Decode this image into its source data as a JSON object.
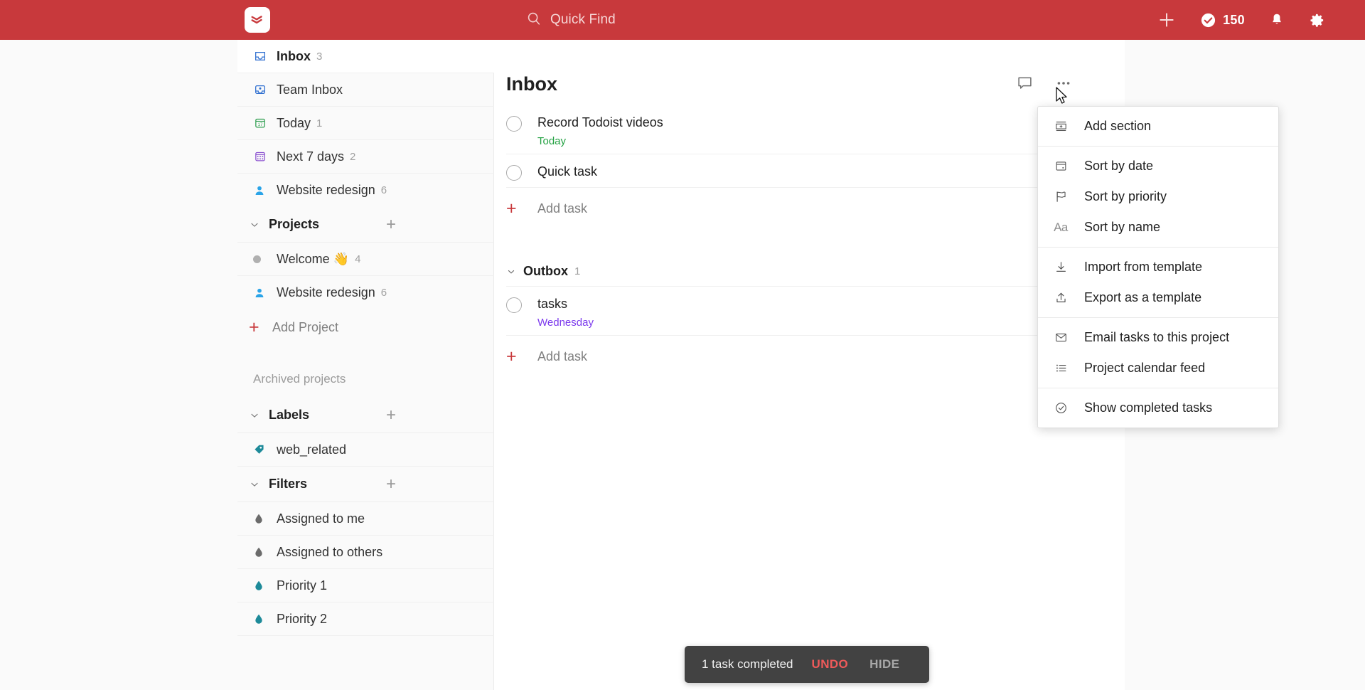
{
  "topbar": {
    "logo_name": "todoist-logo",
    "search_placeholder": "Quick Find",
    "add_label": "+",
    "karma_count": "150",
    "brand_color": "#c8393c"
  },
  "sidebar": {
    "nav_items": [
      {
        "label": "Inbox",
        "count": "3",
        "icon": "inbox-icon",
        "active": true
      },
      {
        "label": "Team Inbox",
        "count": "",
        "icon": "team-inbox-icon",
        "active": false
      },
      {
        "label": "Today",
        "count": "1",
        "icon": "calendar-17-icon",
        "active": false
      },
      {
        "label": "Next 7 days",
        "count": "2",
        "icon": "calendar-grid-icon",
        "active": false
      },
      {
        "label": "Website redesign",
        "count": "6",
        "icon": "person-icon",
        "active": false
      }
    ],
    "projects_section": {
      "title": "Projects",
      "add_label": "+",
      "items": [
        {
          "label": "Welcome 👋",
          "count": "4",
          "icon": "gray-dot-icon"
        },
        {
          "label": "Website redesign",
          "count": "6",
          "icon": "person-icon"
        }
      ],
      "add_project_label": "Add Project",
      "archived_label": "Archived projects"
    },
    "labels_section": {
      "title": "Labels",
      "add_label": "+",
      "items": [
        {
          "label": "web_related",
          "icon": "tag-icon",
          "color": "#1d8a99"
        }
      ]
    },
    "filters_section": {
      "title": "Filters",
      "add_label": "+",
      "items": [
        {
          "label": "Assigned to me",
          "icon": "drop-icon",
          "color": "#6b6b6b"
        },
        {
          "label": "Assigned to others",
          "icon": "drop-icon",
          "color": "#6b6b6b"
        },
        {
          "label": "Priority 1",
          "icon": "drop-icon",
          "color": "#1d8a99"
        },
        {
          "label": "Priority 2",
          "icon": "drop-icon",
          "color": "#1d8a99"
        }
      ]
    }
  },
  "main": {
    "page_title": "Inbox",
    "comment_icon": "comment-icon",
    "more_icon": "more-options-icon",
    "tasks": [
      {
        "title": "Record Todoist videos",
        "date": "Today",
        "date_kind": "today"
      },
      {
        "title": "Quick task",
        "date": "",
        "date_kind": ""
      }
    ],
    "add_task_label": "Add task",
    "section": {
      "title": "Outbox",
      "count": "1",
      "tasks": [
        {
          "title": "tasks",
          "date": "Wednesday",
          "date_kind": "future"
        }
      ],
      "add_task_label": "Add task"
    }
  },
  "menu": {
    "groups": [
      {
        "items": [
          {
            "label": "Add section",
            "icon": "add-section-icon"
          }
        ]
      },
      {
        "items": [
          {
            "label": "Sort by date",
            "icon": "sort-date-icon"
          },
          {
            "label": "Sort by priority",
            "icon": "flag-icon"
          },
          {
            "label": "Sort by name",
            "icon": "aa-text-icon"
          }
        ]
      },
      {
        "items": [
          {
            "label": "Import from template",
            "icon": "download-icon"
          },
          {
            "label": "Export as a template",
            "icon": "upload-icon"
          }
        ]
      },
      {
        "items": [
          {
            "label": "Email tasks to this project",
            "icon": "envelope-icon"
          },
          {
            "label": "Project calendar feed",
            "icon": "list-icon"
          }
        ]
      },
      {
        "items": [
          {
            "label": "Show completed tasks",
            "icon": "check-circle-icon"
          }
        ]
      }
    ]
  },
  "toast": {
    "message": "1 task completed",
    "undo_label": "UNDO",
    "hide_label": "HIDE",
    "background": "#424242",
    "undo_color": "#ef5a5a"
  }
}
